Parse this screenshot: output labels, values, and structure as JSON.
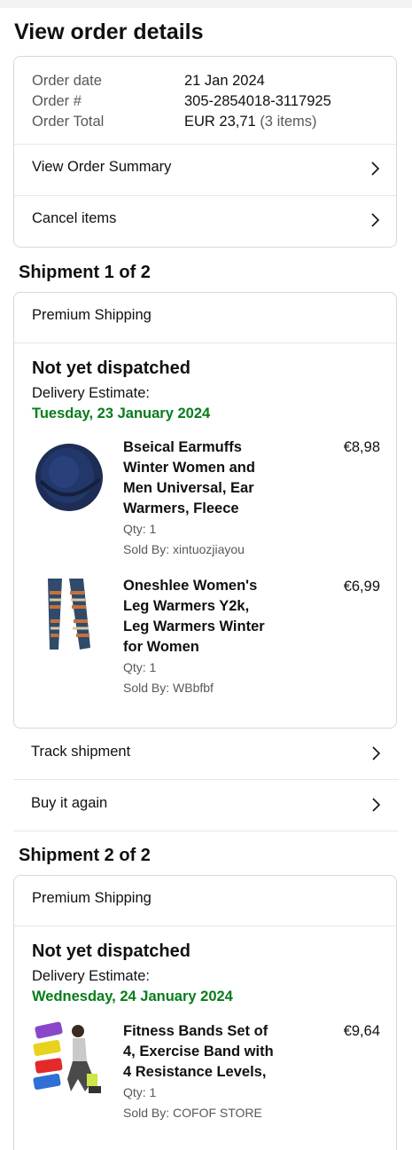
{
  "page": {
    "title": "View order details"
  },
  "order": {
    "date_label": "Order date",
    "date_value": "21 Jan 2024",
    "number_label": "Order #",
    "number_value": "305-2854018-3117925",
    "total_label": "Order Total",
    "total_value": "EUR 23,71",
    "total_items": "(3 items)",
    "summary_link": "View Order Summary",
    "cancel_link": "Cancel items"
  },
  "shipments": [
    {
      "heading": "Shipment 1 of 2",
      "shipping_type": "Premium Shipping",
      "status": "Not yet dispatched",
      "estimate_label": "Delivery Estimate:",
      "estimate_date": "Tuesday, 23 January 2024",
      "items": [
        {
          "title": "Bseical Earmuffs Winter Women and Men Universal, Ear Warmers, Fleece",
          "price": "€8,98",
          "qty": "Qty: 1",
          "seller": "Sold By: xintuozjiayou",
          "image": "navy-earmuffs"
        },
        {
          "title": "Oneshlee Women's Leg Warmers Y2k, Leg Warmers Winter for Women",
          "price": "€6,99",
          "qty": "Qty: 1",
          "seller": "Sold By: WBbfbf",
          "image": "patterned-leg-warmers"
        }
      ],
      "actions": [
        "Track shipment",
        "Buy it again"
      ]
    },
    {
      "heading": "Shipment 2 of 2",
      "shipping_type": "Premium Shipping",
      "status": "Not yet dispatched",
      "estimate_label": "Delivery Estimate:",
      "estimate_date": "Wednesday, 24 January 2024",
      "items": [
        {
          "title": "Fitness Bands Set of 4, Exercise Band with 4 Resistance Levels,",
          "price": "€9,64",
          "qty": "Qty: 1",
          "seller": "Sold By: COFOF STORE",
          "image": "fitness-bands"
        }
      ]
    }
  ],
  "colors": {
    "delivery_green": "#067d1a",
    "border": "#d5d9d9",
    "muted_text": "#565959"
  },
  "icons": {
    "row_arrow": "chevron-right-icon"
  }
}
